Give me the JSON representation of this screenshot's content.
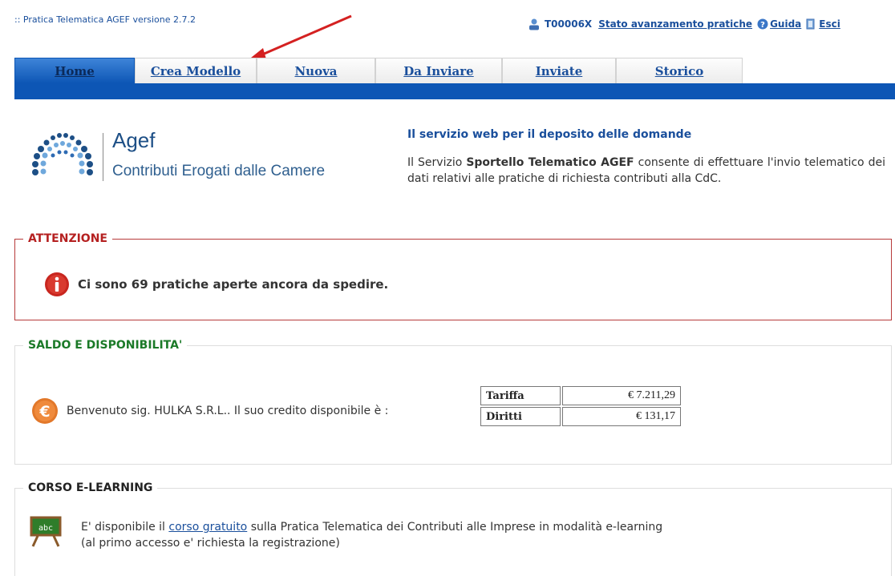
{
  "app": {
    "title": ":: Pratica Telematica AGEF versione 2.7.2"
  },
  "user": {
    "code": "T00006X",
    "progress_link": "Stato avanzamento pratiche",
    "help_link": "Guida",
    "exit_link": "Esci"
  },
  "tabs": [
    {
      "label": "Home",
      "active": true
    },
    {
      "label": "Crea Modello"
    },
    {
      "label": "Nuova"
    },
    {
      "label": "Da Inviare"
    },
    {
      "label": "Inviate"
    },
    {
      "label": "Storico"
    }
  ],
  "brand": {
    "name": "Agef",
    "subtitle": "Contributi Erogati dalle Camere"
  },
  "service": {
    "title": "Il servizio web per il deposito delle domande",
    "desc_prefix": "Il Servizio ",
    "desc_bold": "Sportello Telematico AGEF",
    "desc_suffix": " consente di effettuare l'invio telematico dei dati relativi alle pratiche di richiesta contributi alla CdC."
  },
  "attention": {
    "legend": "ATTENZIONE",
    "message": "Ci sono 69 pratiche aperte ancora da spedire."
  },
  "saldo": {
    "legend": "SALDO E DISPONIBILITA'",
    "welcome": "Benvenuto sig. HULKA S.R.L.. Il suo credito disponibile è :",
    "rows": [
      {
        "label": "Tariffa",
        "value": "€ 7.211,29"
      },
      {
        "label": "Diritti",
        "value": "€ 131,17"
      }
    ]
  },
  "corso": {
    "legend": "CORSO E-LEARNING",
    "line1_prefix": "E' disponibile il ",
    "link": "corso gratuito",
    "line1_suffix": " sulla Pratica Telematica dei Contributi alle Imprese in modalità e-learning",
    "line2": "(al primo accesso e' richiesta la registrazione)",
    "board_text": "abc"
  },
  "colors": {
    "tab_blue": "#0d56b5",
    "link": "#1a4f9c",
    "attention_red": "#b52020",
    "saldo_green": "#1b7a28"
  }
}
